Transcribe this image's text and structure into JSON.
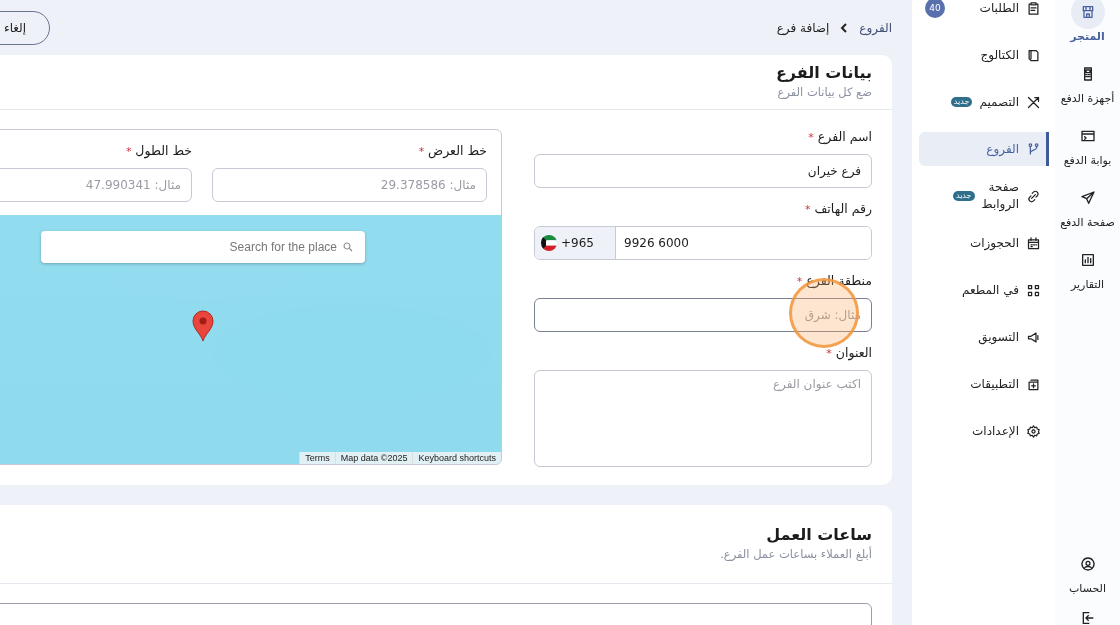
{
  "rail": {
    "items": [
      {
        "label": "المتجر",
        "selected": true
      },
      {
        "label": "أجهزة الدفع",
        "selected": false
      },
      {
        "label": "بوابة الدفع",
        "selected": false
      },
      {
        "label": "صفحة الدفع",
        "selected": false
      },
      {
        "label": "التقارير",
        "selected": false
      }
    ],
    "account": {
      "label": "الحساب"
    }
  },
  "sidebar": {
    "items": [
      {
        "label": "الطلبات",
        "count": "40",
        "selected": false
      },
      {
        "label": "الكتالوج",
        "selected": false
      },
      {
        "label": "التصميم",
        "tag": "جديد",
        "selected": false
      },
      {
        "label": "الفروع",
        "selected": true
      },
      {
        "label": "صفحة\nالروابط",
        "tag": "جديد",
        "selected": false
      },
      {
        "label": "الحجوزات",
        "selected": false
      },
      {
        "label": "في المطعم",
        "selected": false
      },
      {
        "label": "التسويق",
        "selected": false
      },
      {
        "label": "التطبيقات",
        "selected": false
      },
      {
        "label": "الإعدادات",
        "selected": false
      }
    ]
  },
  "breadcrumb": [
    {
      "label": "الفروع"
    },
    {
      "label": "إضافة فرع"
    }
  ],
  "cancel_button": "إلغاء",
  "branch_card": {
    "title": "بيانات الفرع",
    "subtitle": "ضع كل بيانات الفرع",
    "name": {
      "label": "اسم الفرع",
      "required_mark": "*",
      "value": "فرع خيران"
    },
    "phone": {
      "label": "رقم الهاتف",
      "required_mark": "*",
      "country_code": "+965",
      "value": "9926 6000"
    },
    "region": {
      "label": "منطقة الفرع",
      "required_mark": "*",
      "placeholder": "مثال: شرق"
    },
    "address": {
      "label": "العنوان",
      "required_mark": "*",
      "placeholder": "اكتب عنوان الفرع"
    },
    "latitude": {
      "label": "خط العرض",
      "required_mark": "*",
      "placeholder": "مثال: 29.378586"
    },
    "longitude": {
      "label": "خط الطول",
      "required_mark": "*",
      "placeholder": "مثال: 47.990341"
    },
    "map": {
      "search_placeholder": "Search for the place",
      "attribution": [
        "Keyboard shortcuts",
        "Map data ©2025",
        "Terms"
      ]
    }
  },
  "hours_card": {
    "title": "ساعات العمل",
    "subtitle": "أبلغ العملاء بساعات عمل الفرع."
  }
}
